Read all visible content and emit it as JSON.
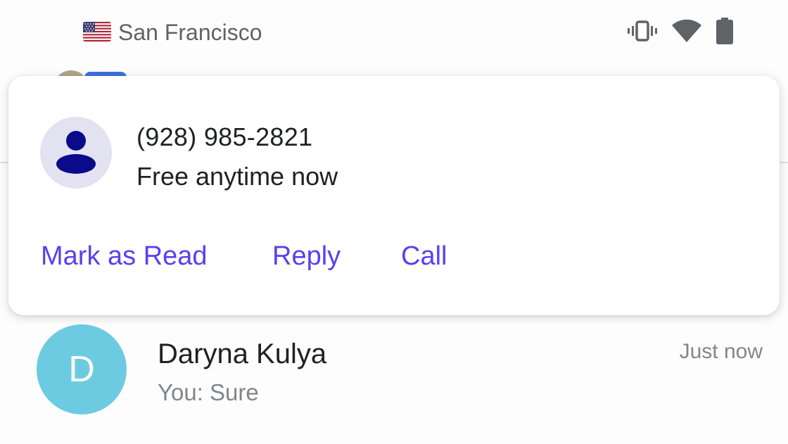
{
  "status_bar": {
    "location": "San Francisco",
    "icons": [
      "us-flag-icon",
      "vibrate-icon",
      "wifi-icon",
      "battery-icon"
    ]
  },
  "notification": {
    "sender": "(928) 985-2821",
    "message": "Free anytime now",
    "avatar_icon": "person-icon",
    "actions": {
      "mark_as_read": "Mark as Read",
      "reply": "Reply",
      "call": "Call"
    }
  },
  "conversation": {
    "avatar_initial": "D",
    "name": "Daryna Kulya",
    "snippet": "You: Sure",
    "time": "Just now"
  },
  "colors": {
    "action_accent": "#5b3ff0",
    "contact_avatar_bg": "#e3e2f1",
    "contact_avatar_fg": "#0a0a8a",
    "conversation_avatar_bg": "#6ccbe0",
    "secondary_text": "#80868b"
  }
}
